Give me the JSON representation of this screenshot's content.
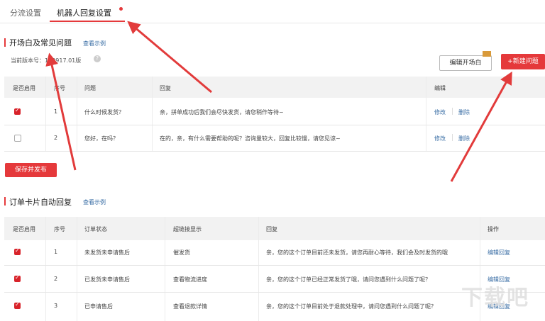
{
  "tabs": [
    {
      "label": "分流设置"
    },
    {
      "label": "机器人回复设置"
    }
  ],
  "section1": {
    "title": "开场白及常见问题",
    "example_link": "查看示例",
    "version": "当前版本号：",
    "version_tail": "170917.01版",
    "edit_opening_label": "编辑开场白",
    "new_question_label": "+新建问题",
    "headers": [
      "是否启用",
      "序号",
      "问题",
      "回复",
      "编辑"
    ],
    "rows": [
      {
        "enabled": true,
        "no": "1",
        "question": "什么时候发货？",
        "reply": "亲，拼单成功后我们会尽快发货，请您稍作等待~",
        "edit": "修改",
        "del": "删除"
      },
      {
        "enabled": false,
        "no": "2",
        "question": "您好，在吗？",
        "reply": "在的，亲，有什么需要帮助的呢？咨询量较大，回复比较慢，请您见谅~",
        "edit": "修改",
        "del": "删除"
      }
    ],
    "save_label": "保存并发布"
  },
  "section2": {
    "title": "订单卡片自动回复",
    "example_link": "查看示例",
    "headers": [
      "是否启用",
      "序号",
      "订单状态",
      "超链接显示",
      "回复",
      "操作"
    ],
    "rows": [
      {
        "enabled": true,
        "no": "1",
        "status": "未发货未申请售后",
        "link": "催发货",
        "reply": "亲，您的这个订单目前还未发货，请您再耐心等待，我们会及时发货的哦",
        "action": "编辑回复"
      },
      {
        "enabled": true,
        "no": "2",
        "status": "已发货未申请售后",
        "link": "查看物流进度",
        "reply": "亲，您的这个订单已经正常发货了哦，请问您遇到什么问题了呢？",
        "action": "编辑回复"
      },
      {
        "enabled": true,
        "no": "3",
        "status": "已申请售后",
        "link": "查看退款详情",
        "reply": "亲，您的这个订单目前处于退款处理中，请问您遇到什么问题了呢？",
        "action": "编辑回复"
      }
    ]
  },
  "colors": {
    "accent": "#e5393b",
    "link": "#3a6ea5"
  }
}
